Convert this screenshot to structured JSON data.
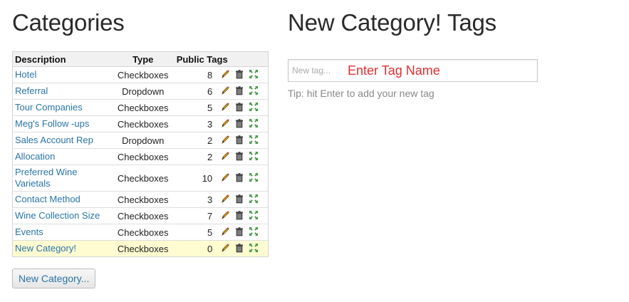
{
  "categories_panel": {
    "title": "Categories",
    "headers": {
      "description": "Description",
      "type": "Type",
      "count": "Public Tags"
    },
    "rows": [
      {
        "description": "Hotel",
        "type": "Checkboxes",
        "count": "8"
      },
      {
        "description": "Referral",
        "type": "Dropdown",
        "count": "6"
      },
      {
        "description": "Tour Companies",
        "type": "Checkboxes",
        "count": "5"
      },
      {
        "description": "Meg's Follow -ups",
        "type": "Checkboxes",
        "count": "3"
      },
      {
        "description": "Sales Account Rep",
        "type": "Dropdown",
        "count": "2"
      },
      {
        "description": "Allocation",
        "type": "Checkboxes",
        "count": "2"
      },
      {
        "description": "Preferred Wine Varietals",
        "type": "Checkboxes",
        "count": "10"
      },
      {
        "description": "Contact Method",
        "type": "Checkboxes",
        "count": "3"
      },
      {
        "description": "Wine Collection Size",
        "type": "Checkboxes",
        "count": "7"
      },
      {
        "description": "Events",
        "type": "Checkboxes",
        "count": "5"
      },
      {
        "description": "New Category!",
        "type": "Checkboxes",
        "count": "0"
      }
    ],
    "row_icons": [
      "pencil-icon",
      "trash-icon",
      "expand-icon"
    ],
    "new_button_label": "New Category..."
  },
  "tags_panel": {
    "title": "New Category! Tags",
    "input_placeholder": "New tag...",
    "annotation": "Enter Tag Name",
    "tip": "Tip: hit Enter to add your new tag"
  },
  "colors": {
    "link": "#2a74a8",
    "selected_row": "#fefcd0",
    "annotation": "#e03030"
  }
}
